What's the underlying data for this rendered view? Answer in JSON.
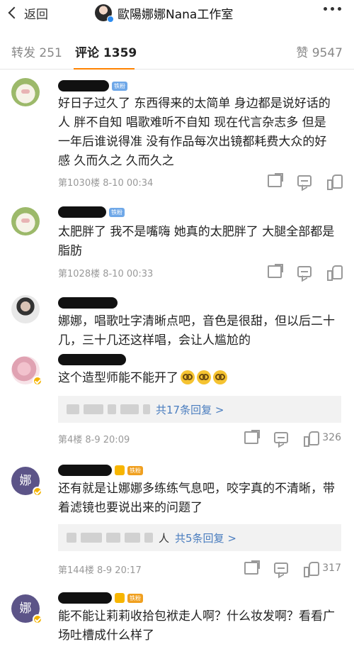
{
  "header": {
    "back_label": "返回",
    "title": "歐陽娜娜Nana工作室"
  },
  "tabs": [
    {
      "label": "转发 251"
    },
    {
      "label": "评论 1359"
    },
    {
      "label": "赞 9547"
    }
  ],
  "fan_badge": "铁粉",
  "comments": [
    {
      "text": "好日子过久了 东西得来的太简单 身边都是说好话的人 胖不自知 唱歌难听不自知 现在代言杂志多 但是一年后谁说得准 没有作品每次出镜都耗费大众的好感 久而久之 久而久之",
      "meta": "第1030楼  8-10 00:34"
    },
    {
      "text": "太肥胖了 我不是嘴嗨 她真的太肥胖了 大腿全部都是脂肪",
      "meta": "第1028楼  8-10 00:33"
    },
    {
      "text": "娜娜，唱歌吐字清晰点吧，音色是很甜，但以后二十几，三十几还这样唱，会让人尴尬的"
    },
    {
      "text": "这个造型师能不能开了",
      "reply": "共17条回复 >",
      "meta": "第4楼  8-9 20:09",
      "likes": "326"
    },
    {
      "avatar_text": "娜",
      "text": "还有就是让娜娜多练练气息吧，咬字真的不清晰，带着滤镜也要说出来的问题了",
      "reply_prefix": "人",
      "reply": "共5条回复 >",
      "meta": "第144楼  8-9 20:17",
      "likes": "317"
    },
    {
      "avatar_text": "娜",
      "text": "能不能让莉莉收拾包袱走人啊？什么妆发啊？看看广场吐槽成什么样了"
    }
  ]
}
